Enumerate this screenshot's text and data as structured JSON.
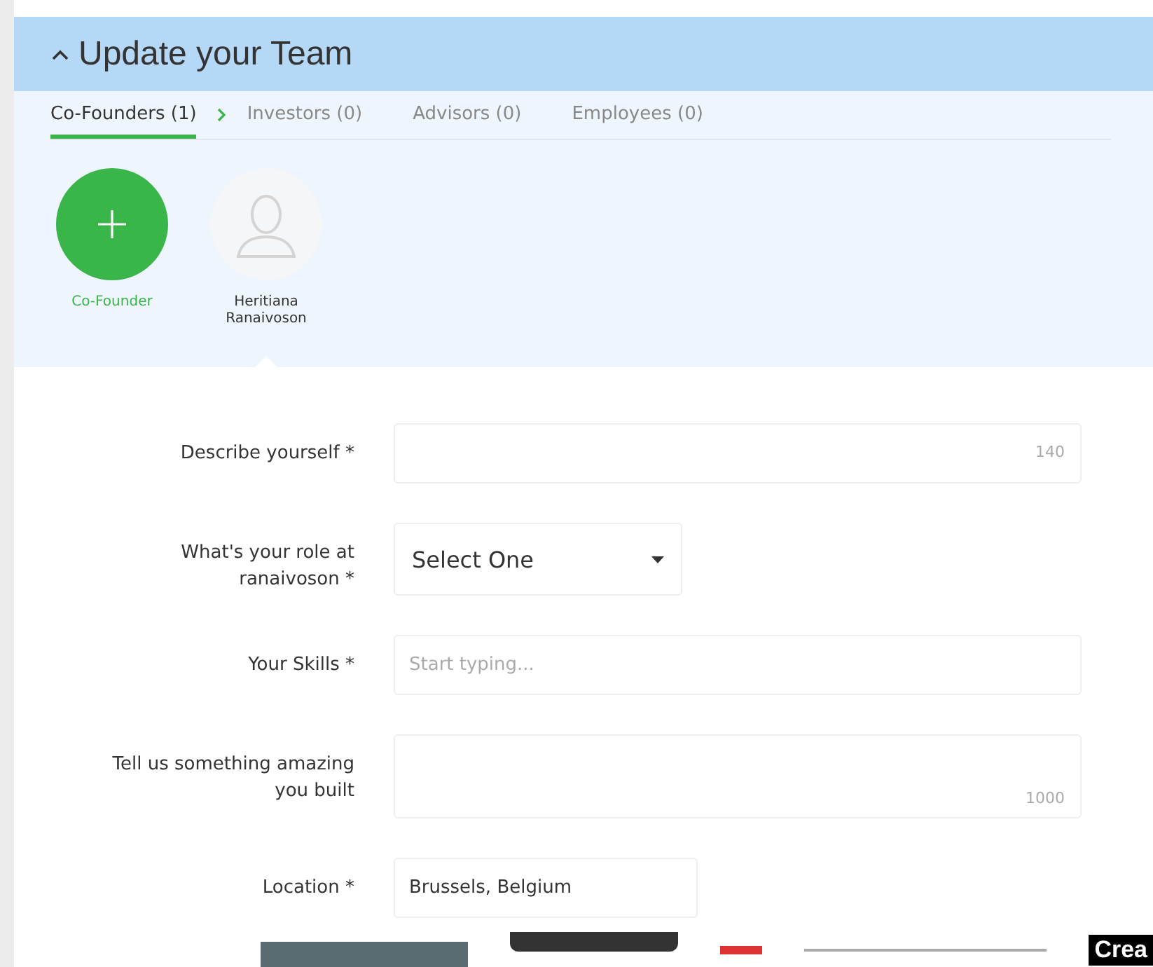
{
  "header": {
    "title": "Update your Team",
    "expanded": true
  },
  "tabs": [
    {
      "label": "Co-Founders (1)",
      "selected": true
    },
    {
      "label": "Investors (0)",
      "selected": false
    },
    {
      "label": "Advisors (0)",
      "selected": false
    },
    {
      "label": "Employees (0)",
      "selected": false
    }
  ],
  "members": [
    {
      "kind": "add",
      "label": "Co-Founder",
      "selected": false
    },
    {
      "kind": "person",
      "label": "Heritiana Ranaivoson",
      "selected": true
    }
  ],
  "form": [
    {
      "kind": "text",
      "label": "Describe yourself *",
      "counter": "140"
    },
    {
      "kind": "select",
      "label": "What's your role at ranaivoson *",
      "value": "Select One"
    },
    {
      "kind": "text",
      "label": "Your Skills *",
      "placeholder": "Start typing..."
    },
    {
      "kind": "textarea",
      "label": "Tell us something amazing you built",
      "counter": "1000"
    },
    {
      "kind": "short",
      "label": "Location *",
      "value": "Brussels, Belgium"
    }
  ],
  "footer": {
    "banner_text": "Crea"
  }
}
